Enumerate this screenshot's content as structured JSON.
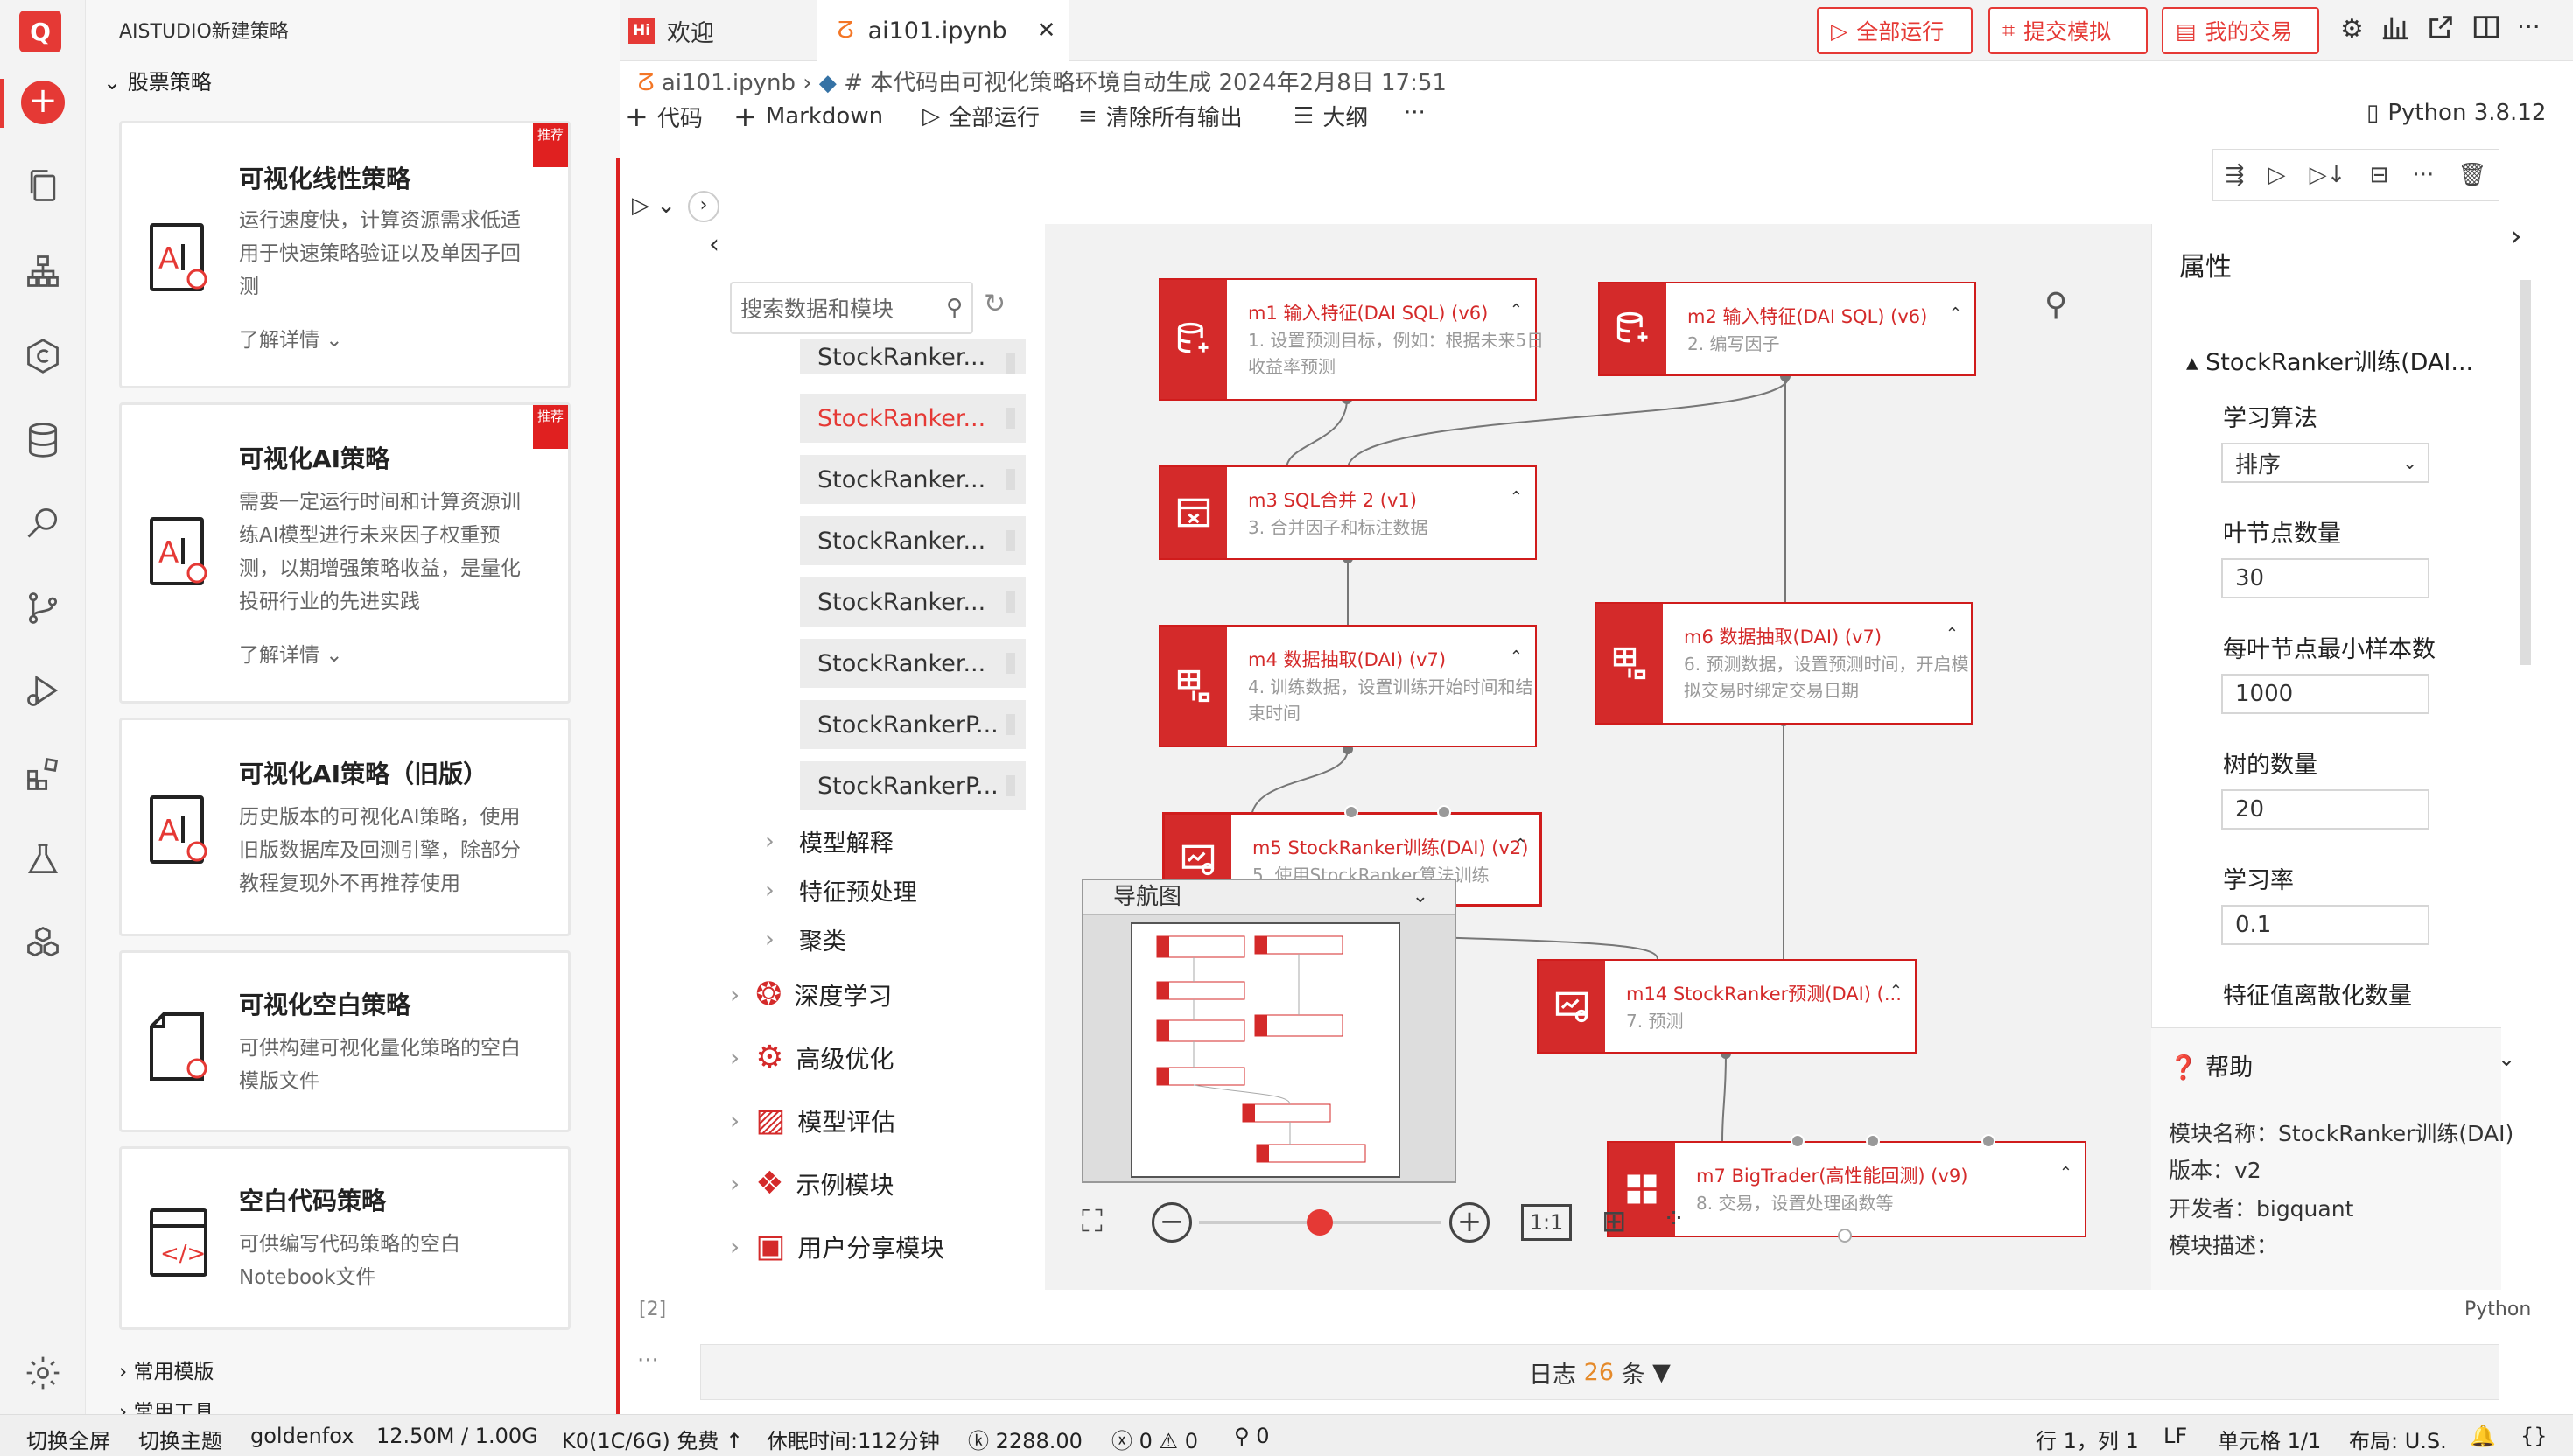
{
  "activity_bar": {
    "logo": "Q",
    "icons": [
      "add-icon",
      "files-icon",
      "hierarchy-icon",
      "coin-icon",
      "database-icon",
      "search-icon",
      "source-control-icon",
      "run-debug-icon",
      "extensions-icon",
      "flask-icon",
      "cubes-icon"
    ],
    "settings_icon": "gear-icon"
  },
  "left_panel": {
    "header": "AISTUDIO新建策略",
    "section": "股票策略",
    "cards": [
      {
        "title": "可视化线性策略",
        "desc": "运行速度快，计算资源需求低适用于快速策略验证以及单因子回测",
        "more": "了解详情",
        "tag": "推荐"
      },
      {
        "title": "可视化AI策略",
        "desc": "需要一定运行时间和计算资源训练AI模型进行未来因子权重预测，以期增强策略收益，是量化投研行业的先进实践",
        "more": "了解详情",
        "tag": "推荐"
      },
      {
        "title": "可视化AI策略（旧版）",
        "desc": "历史版本的可视化AI策略，使用旧版数据库及回测引擎，除部分教程复现外不再推荐使用"
      },
      {
        "title": "可视化空白策略",
        "desc": "可供构建可视化量化策略的空白模版文件"
      },
      {
        "title": "空白代码策略",
        "desc": "可供编写代码策略的空白Notebook文件"
      }
    ],
    "footer": [
      "常用模版",
      "常用工具"
    ]
  },
  "tabs": [
    {
      "label": "欢迎",
      "icon": "hi-icon"
    },
    {
      "label": "ai101.ipynb",
      "icon": "jupyter-icon"
    }
  ],
  "top_buttons": [
    "全部运行",
    "提交模拟",
    "我的交易"
  ],
  "breadcrumb": {
    "file": "ai101.ipynb",
    "comment": "# 本代码由可视化策略环境自动生成 2024年2月8日 17:51"
  },
  "toolbar": {
    "code": "代码",
    "markdown": "Markdown",
    "run_all": "全部运行",
    "clear": "清除所有输出",
    "outline": "大纲",
    "more": "···",
    "kernel": "Python 3.8.12"
  },
  "cell": {
    "index": "[2]",
    "lang": "Python"
  },
  "module_search": {
    "placeholder": "搜索数据和模块"
  },
  "module_list": [
    "StockRanker...",
    "StockRanker...",
    "StockRanker...",
    "StockRanker...",
    "StockRanker...",
    "StockRanker...",
    "StockRankerP...",
    "StockRankerP..."
  ],
  "subcats": [
    "模型解释",
    "特征预处理",
    "聚类"
  ],
  "categories": [
    "深度学习",
    "高级优化",
    "模型评估",
    "示例模块",
    "用户分享模块"
  ],
  "nodes": {
    "m1": {
      "title": "m1 输入特征(DAI SQL) (v6)",
      "desc": "1. 设置预测目标，例如：根据未来5日收益率预测"
    },
    "m2": {
      "title": "m2 输入特征(DAI SQL) (v6)",
      "desc": "2. 编写因子"
    },
    "m3": {
      "title": "m3 SQL合并 2 (v1)",
      "desc": "3. 合并因子和标注数据"
    },
    "m4": {
      "title": "m4 数据抽取(DAI) (v7)",
      "desc": "4. 训练数据，设置训练开始时间和结束时间"
    },
    "m6": {
      "title": "m6 数据抽取(DAI) (v7)",
      "desc": "6. 预测数据，设置预测时间，开启模拟交易时绑定交易日期"
    },
    "m5": {
      "title": "m5 StockRanker训练(DAI) (v2)",
      "desc": "5. 使用StockRanker算法训练"
    },
    "m14": {
      "title": "m14 StockRanker预测(DAI) (...",
      "desc": "7. 预测"
    },
    "m7": {
      "title": "m7 BigTrader(高性能回测) (v9)",
      "desc": "8. 交易，设置处理函数等"
    }
  },
  "navigator": {
    "title": "导航图"
  },
  "zoom": {
    "level": 0.5,
    "ratio_label": "1:1"
  },
  "properties": {
    "title": "属性",
    "section": "StockRanker训练(DAI...",
    "fields": [
      {
        "label": "学习算法",
        "value": "排序"
      },
      {
        "label": "叶节点数量",
        "value": "30"
      },
      {
        "label": "每叶节点最小样本数",
        "value": "1000"
      },
      {
        "label": "树的数量",
        "value": "20"
      },
      {
        "label": "学习率",
        "value": "0.1"
      },
      {
        "label": "特征值离散化数量",
        "value": ""
      }
    ]
  },
  "help": {
    "title": "帮助",
    "name": "模块名称：StockRanker训练(DAI)",
    "version": "版本：v2",
    "dev": "开发者：bigquant",
    "desc": "模块描述："
  },
  "log": {
    "prefix": "日志",
    "count": "26",
    "suffix": "条"
  },
  "statusbar": {
    "fullscreen": "切换全屏",
    "theme": "切换主题",
    "user": "goldenfox",
    "mem": "12.50M / 1.00G",
    "kernel": "K0(1C/6G) 免费 ↑",
    "idle": "休眠时间:112分钟",
    "credits": "2288.00",
    "errors": "0",
    "warnings": "0",
    "ports": "0",
    "pos": "行 1，列 1",
    "eol": "LF",
    "cell": "单元格 1/1",
    "layout": "布局: U.S."
  },
  "colors": {
    "accent": "#e53935",
    "node": "#d42a2a"
  }
}
